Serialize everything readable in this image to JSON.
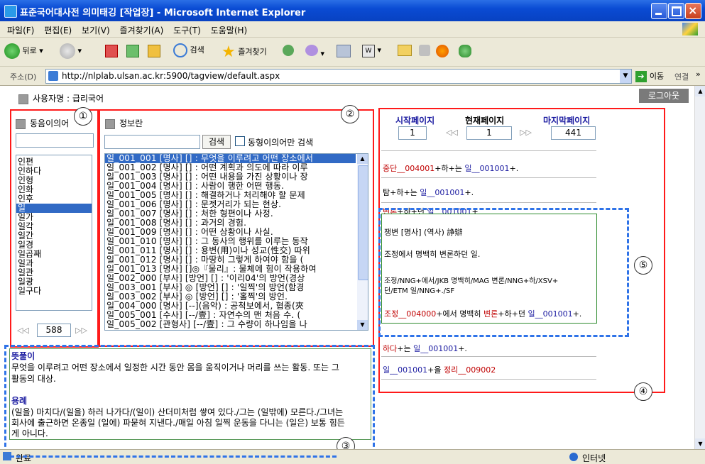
{
  "window": {
    "title": "표준국어대사전 의미태깅 [작업장] - Microsoft Internet Explorer"
  },
  "menu": [
    "파일(F)",
    "편집(E)",
    "보기(V)",
    "즐겨찾기(A)",
    "도구(T)",
    "도움말(H)"
  ],
  "toolbar": {
    "back_label": "뒤로",
    "search_label": "검색",
    "favorites_label": "즐겨찾기"
  },
  "address": {
    "label": "주소(D)",
    "url": "http://nlplab.ulsan.ac.kr:5900/tagview/default.aspx",
    "go_label": "이동",
    "links_label": "연결"
  },
  "header": {
    "nav_text": "사용자명 : 급리국어",
    "logout_label": "로그아웃"
  },
  "homonym_panel": {
    "title": "동음이의어",
    "search_value": "",
    "words": [
      "인편",
      "인하다",
      "인형",
      "인화",
      "인후",
      "일",
      "일가",
      "일각",
      "일간",
      "일경",
      "일곱째",
      "일과",
      "일관",
      "일광",
      "일구다"
    ],
    "selected_index": 5,
    "prev_label": "◁◁",
    "page_value": "588",
    "next_label": "▷▷"
  },
  "info_panel": {
    "title": "정보란",
    "search_value": "",
    "search_button": "검색",
    "checkbox_label": "동형이의어만 검색",
    "senses": [
      "일_001_001 [명사] [] : 무엇을 이루려고 어떤 장소에서",
      "일_001_002 [명사] [] : 어떤 계획과 의도에 따라 이루",
      "일_001_003 [명사] [] : 어떤 내용을 가진 상황이나 장",
      "일_001_004 [명사] [] : 사람이 행한 어떤 행동.",
      "일_001_005 [명사] [] : 해결하거나 처리해야 할 문제",
      "일_001_006 [명사] [] : 문젯거리가 되는 현상.",
      "일_001_007 [명사] [] : 처한 형편이나 사정.",
      "일_001_008 [명사] [] : 과거의 경험.",
      "일_001_009 [명사] [] : 어떤 상황이나 사실.",
      "일_001_010 [명사] [] : 그 동사의 행위를 이루는 동작",
      "일_001_011 [명사] [] : 용변(用)이나 성교(性交) 따위",
      "일_001_012 [명사] [] : 마땅히 그렇게 하여야 함을 (",
      "일_001_013 [명사] []◎『물리』: 물체에 힘이 작용하여",
      "일_002_000 [부사] [방언] [] : '이리04'의 방언(경상",
      "일_003_001 [부사] ◎ [방언] [] : '일찍'의 방언(함경",
      "일_003_002 [부사] ◎ [방언] [] : '홀찍'의 방언.",
      "일_004_000 [명사] [--](음악) : 공척보에서, 협종(夾",
      "일_005_001 [수사] [--/壹] : 자연수의 맨 처음 수. (",
      "일_005_002 [관형사] [--/壹] : 그 수량이 하나임을 나"
    ],
    "selected_index": 0
  },
  "pagination": {
    "start_label": "시작페이지",
    "start_value": "1",
    "prev_label": "◁◁",
    "current_label": "현재페이지",
    "current_value": "1",
    "next_label": "▷▷",
    "last_label": "마지막페이지",
    "last_value": "441"
  },
  "sentences": {
    "s1": {
      "a": "중단__004001",
      "b": "+하+는 ",
      "c": "일__001001",
      "d": "+."
    },
    "s2": {
      "a": "탐+하+는 ",
      "b": "일__001001",
      "c": "+."
    },
    "s3": {
      "a": "변론",
      "b": "+하+던 ",
      "c": "일__001001",
      "d": "+"
    },
    "s4": {
      "a": "하다",
      "b": "+는 ",
      "c": "일__001001",
      "d": "+."
    },
    "s5": {
      "a": "일__001001",
      "b": "+을 ",
      "c": "정리__009002"
    }
  },
  "popup": {
    "headword": "쟁변 [명사] (역사) 諍辯",
    "sentence": "조정에서 명백히 변론하던 일.",
    "morph_line1": "조정/NNG+에서/JKB 명백히/MAG 변론/NNG+하/XSV+",
    "morph_line2": "던/ETM 일/NNG+./SF",
    "tagged": {
      "a": "조정__004000",
      "b": "+에서 명백히 ",
      "c": "변론",
      "d": "+하+던 ",
      "e": "일__001001",
      "f": "+."
    }
  },
  "definition_panel": {
    "meaning_title": "뜻풀이",
    "meaning_text1": "무엇을 이루려고 어떤 장소에서 일정한 시간 동안 몸을 움직이거나 머리를 쓰는 활동. 또는 그",
    "meaning_text2": "활동의 대상.",
    "usage_title": "용례",
    "usage_text1": "(일을) 마치다/(일을) 하러 나가다/(일이) 산더미처럼 쌓여 있다./그는 (일밖에) 모른다./그녀는",
    "usage_text2": "회사에 출근하면 온종일 (일에) 파묻혀 지낸다./매일 아침 일찍 운동을 다니는 (일은) 보통 힘든",
    "usage_text3": "게 아니다."
  },
  "annotations": [
    "①",
    "②",
    "③",
    "④",
    "⑤"
  ],
  "status": {
    "left": "완료",
    "zone": "인터넷"
  },
  "colors": {
    "accent_red": "#ff1a1a",
    "accent_blue": "#2f73e8",
    "selection": "#316ac5",
    "tag_red": "#c00000",
    "tag_blue": "#1a1aa0",
    "nav_blue": "#1a1aa0"
  }
}
